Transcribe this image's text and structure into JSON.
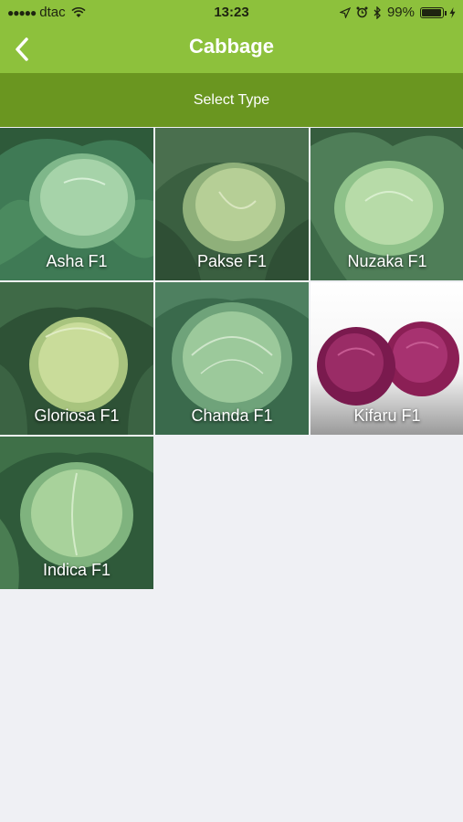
{
  "status_bar": {
    "carrier": "dtac",
    "time": "13:23",
    "battery": "99%",
    "battery_level": 0.99
  },
  "nav": {
    "title": "Cabbage"
  },
  "subheader": {
    "text": "Select Type"
  },
  "varieties": [
    {
      "name": "Asha F1"
    },
    {
      "name": "Pakse F1"
    },
    {
      "name": "Nuzaka F1"
    },
    {
      "name": "Gloriosa F1"
    },
    {
      "name": "Chanda F1"
    },
    {
      "name": "Kifaru F1"
    },
    {
      "name": "Indica F1"
    }
  ],
  "colors": {
    "navbar": "#8dc13c",
    "subheader": "#6a9620",
    "background": "#eff0f4"
  }
}
